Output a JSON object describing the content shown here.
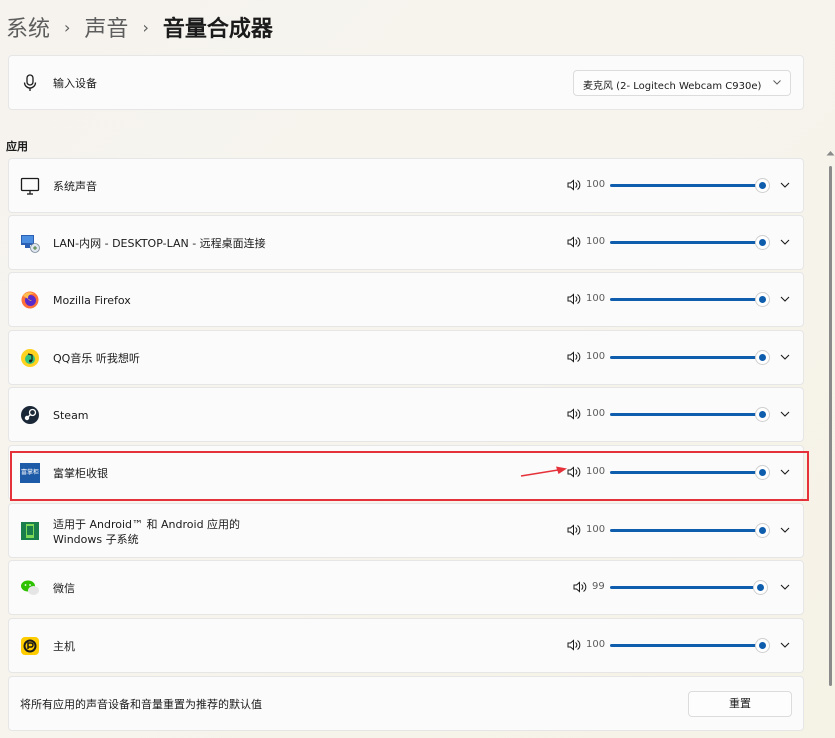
{
  "breadcrumb": {
    "level1": "系统",
    "level2": "声音",
    "current": "音量合成器",
    "separator": "›"
  },
  "input_device": {
    "label": "输入设备",
    "selected": "麦克风 (2- Logitech Webcam C930e)",
    "icon": "microphone-icon"
  },
  "apps_section_title": "应用",
  "apps": [
    {
      "name": "系统声音",
      "volume": 100,
      "icon": "monitor-icon"
    },
    {
      "name": "LAN-内网 - DESKTOP-LAN - 远程桌面连接",
      "volume": 100,
      "icon": "remote-desktop-icon"
    },
    {
      "name": "Mozilla Firefox",
      "volume": 100,
      "icon": "firefox-icon"
    },
    {
      "name": "QQ音乐 听我想听",
      "volume": 100,
      "icon": "qq-music-icon"
    },
    {
      "name": "Steam",
      "volume": 100,
      "icon": "steam-icon"
    },
    {
      "name": "富掌柜收银",
      "volume": 100,
      "icon": "fuzhanggui-icon"
    },
    {
      "name": "适用于 Android™ 和 Android 应用的",
      "name2": "Windows 子系统",
      "volume": 100,
      "icon": "android-subsystem-icon"
    },
    {
      "name": "微信",
      "volume": 99,
      "icon": "wechat-icon"
    },
    {
      "name": "主机",
      "volume": 100,
      "icon": "host-icon"
    }
  ],
  "fuzhanggui_icon_text": "富掌柜",
  "reset": {
    "description": "将所有应用的声音设备和音量重置为推荐的默认值",
    "button": "重置"
  },
  "colors": {
    "accent": "#0f5eae",
    "highlight": "#e5323a"
  }
}
